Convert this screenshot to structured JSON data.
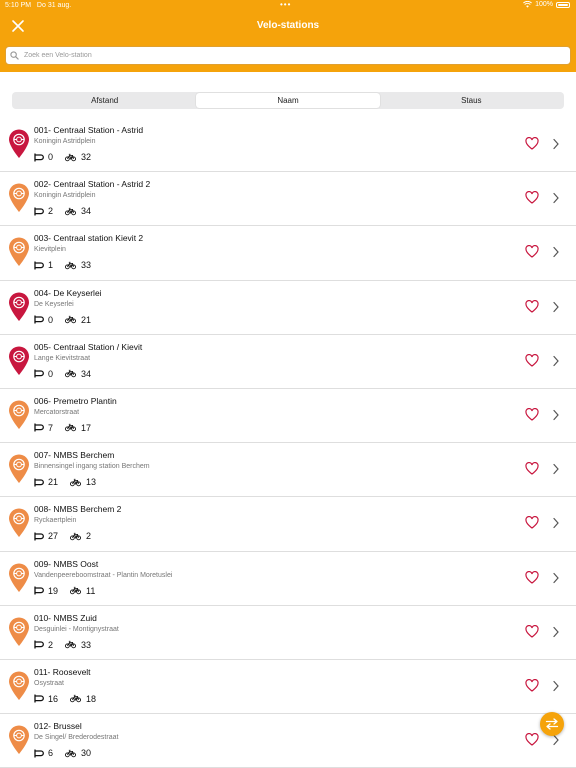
{
  "status_bar": {
    "time": "5:10 PM",
    "date": "Do 31 aug.",
    "battery": "100%"
  },
  "header": {
    "title": "Velo-stations"
  },
  "search": {
    "placeholder": "Zoek een Velo-station"
  },
  "tabs": [
    {
      "label": "Afstand",
      "active": false
    },
    {
      "label": "Naam",
      "active": true
    },
    {
      "label": "Staus",
      "active": false
    }
  ],
  "colors": {
    "brand": "#f5a30b",
    "pin_red": "#c8173f",
    "pin_orange": "#ee8c47"
  },
  "stations": [
    {
      "name": "001- Centraal Station - Astrid",
      "address": "Koningin Astridplein",
      "slots": "0",
      "bikes": "32",
      "pin": "red"
    },
    {
      "name": "002- Centraal Station - Astrid 2",
      "address": "Koningin Astridplein",
      "slots": "2",
      "bikes": "34",
      "pin": "orange"
    },
    {
      "name": "003- Centraal station Kievit 2",
      "address": "Kievitplein",
      "slots": "1",
      "bikes": "33",
      "pin": "orange"
    },
    {
      "name": "004- De Keyserlei",
      "address": "De Keyserlei",
      "slots": "0",
      "bikes": "21",
      "pin": "red"
    },
    {
      "name": "005- Centraal Station / Kievit",
      "address": "Lange Kievitstraat",
      "slots": "0",
      "bikes": "34",
      "pin": "red"
    },
    {
      "name": "006- Premetro Plantin",
      "address": "Mercatorstraat",
      "slots": "7",
      "bikes": "17",
      "pin": "orange"
    },
    {
      "name": "007- NMBS Berchem",
      "address": "Binnensingel ingang station Berchem",
      "slots": "21",
      "bikes": "13",
      "pin": "orange"
    },
    {
      "name": "008- NMBS Berchem 2",
      "address": "Ryckaertplein",
      "slots": "27",
      "bikes": "2",
      "pin": "orange"
    },
    {
      "name": "009- NMBS Oost",
      "address": "Vandenpeereboomstraat - Plantin Moretuslei",
      "slots": "19",
      "bikes": "11",
      "pin": "orange"
    },
    {
      "name": "010- NMBS Zuid",
      "address": "Desguinlei - Montignystraat",
      "slots": "2",
      "bikes": "33",
      "pin": "orange"
    },
    {
      "name": "011- Roosevelt",
      "address": "Osystraat",
      "slots": "16",
      "bikes": "18",
      "pin": "orange"
    },
    {
      "name": "012- Brussel",
      "address": "De Singel/ Brederodestraat",
      "slots": "6",
      "bikes": "30",
      "pin": "orange"
    }
  ]
}
